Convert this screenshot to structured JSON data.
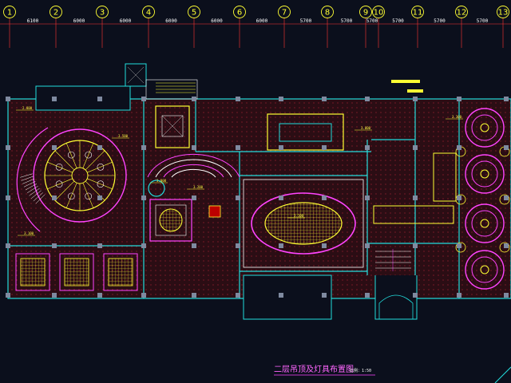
{
  "drawing": {
    "axis_labels": [
      "1",
      "2",
      "3",
      "4",
      "5",
      "6",
      "7",
      "8",
      "9",
      "10",
      "11",
      "12",
      "13"
    ],
    "dimensions": [
      "6100",
      "6000",
      "6000",
      "6000",
      "6000",
      "6000",
      "5700",
      "5700",
      "5700",
      "5700",
      "5700",
      "5700"
    ],
    "room_tags": [
      "2.800",
      "3.100",
      "3.500",
      "3.000",
      "3.200",
      "3.000",
      "3.300",
      "3.100"
    ],
    "title": "二层吊顶及灯具布置图",
    "scale": "比例：1:50"
  },
  "colors": {
    "background": "#0b0f1c",
    "wall": "#22dddd",
    "fixture": "#ffff33",
    "accent": "#ff44ff",
    "axis": "#ff3333",
    "grid_fill": "#3a1018"
  }
}
